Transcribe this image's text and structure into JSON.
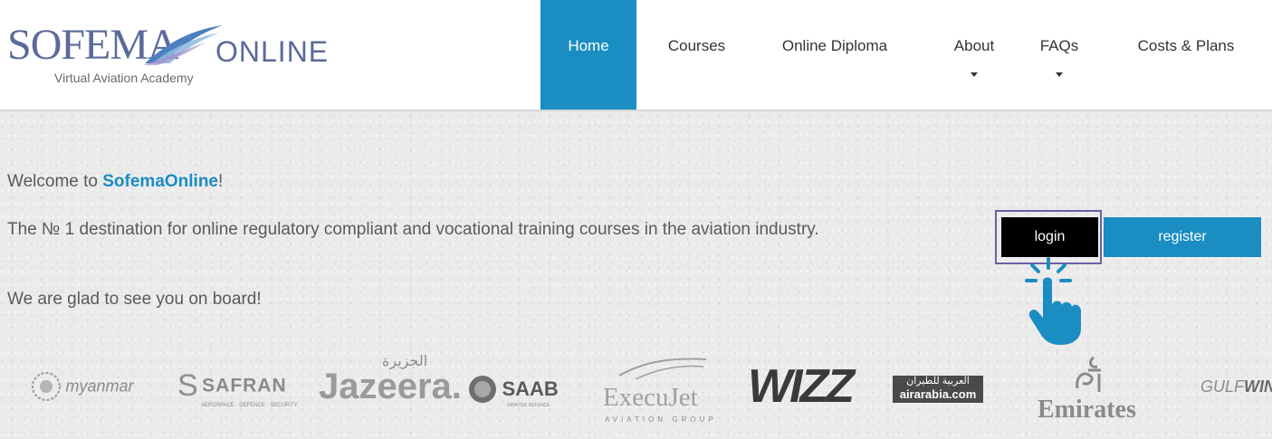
{
  "header": {
    "logo": {
      "main": "SOFEMA",
      "online": "ONLINE",
      "subtitle": "Virtual Aviation Academy"
    },
    "nav": [
      {
        "label": "Home",
        "active": true
      },
      {
        "label": "Courses"
      },
      {
        "label": "Online Diploma"
      },
      {
        "label": "About",
        "has_dropdown": true
      },
      {
        "label": "FAQs",
        "has_dropdown": true
      },
      {
        "label": "Costs & Plans"
      }
    ]
  },
  "main": {
    "welcome_prefix": "Welcome to ",
    "welcome_brand": "SofemaOnline",
    "welcome_suffix": "!",
    "tagline": "The № 1 destination for online regulatory compliant and vocational training courses in the aviation industry.",
    "glad": "We are glad to see you on board!",
    "login_label": "login",
    "register_label": "register"
  },
  "partners": {
    "myanmar": "myanmar",
    "safran": "SAFRAN",
    "safran_sub": "AEROSPACE · DEFENCE · SECURITY",
    "jazeera_ar": "الجزيرة",
    "jazeera": "Jazeera.",
    "saab": "SAAB",
    "saab_sub": "GRINTEK DEFENCE",
    "execujet": "ExecuJet",
    "execujet_sub": "AVIATION GROUP",
    "wizz": "WIZZ",
    "airarabia_ar": "العربية للطيران",
    "airarabia": "airarabia.com",
    "emirates": "Emirates",
    "gulfwings_a": "GULF",
    "gulfwings_b": "WING"
  },
  "colors": {
    "accent": "#1a8dc2",
    "login_bg": "#000000",
    "highlight_border": "#6b5fa8"
  }
}
